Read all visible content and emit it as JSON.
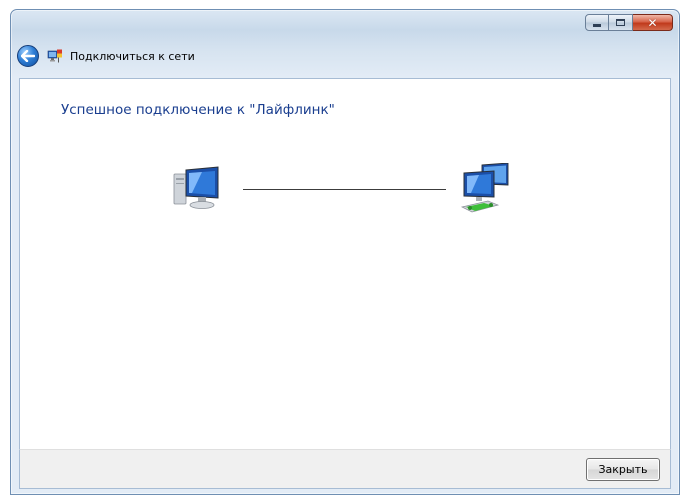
{
  "window": {
    "title": "Подключиться к сети",
    "caption": {
      "minimize_icon": "minimize-icon",
      "maximize_icon": "maximize-icon",
      "close_icon": "close-icon",
      "close_glyph": "✕"
    }
  },
  "main": {
    "heading": "Успешное подключение к \"Лайфлинк\"",
    "left_icon": "computer-icon",
    "right_icon": "network-icon"
  },
  "footer": {
    "close_label": "Закрыть"
  },
  "colors": {
    "heading": "#1a3e8f",
    "frame": "#6f8fb3",
    "close_caption": "#c03a1c"
  }
}
